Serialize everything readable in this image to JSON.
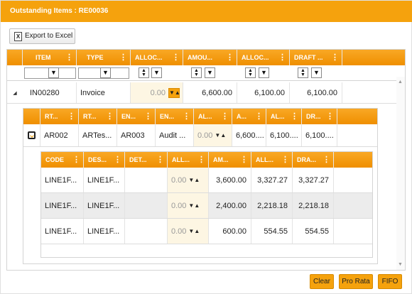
{
  "title": "Outstanding Items : RE00036",
  "toolbar": {
    "export_label": "Export to Excel",
    "export_icon": "excel-icon"
  },
  "main_grid": {
    "headers": [
      "ITEM",
      "TYPE",
      "ALLOC...",
      "AMOU...",
      "ALLOC...",
      "DRAFT ..."
    ],
    "row": {
      "item": "IN00280",
      "type": "Invoice",
      "alloc": "0.00",
      "amount": "6,600.00",
      "alloc2": "6,100.00",
      "draft": "6,100.00"
    }
  },
  "sub_grid": {
    "headers": [
      "RT...",
      "RT...",
      "EN...",
      "EN...",
      "AL...",
      "A...",
      "AL...",
      "DR..."
    ],
    "row": {
      "c1": "AR002",
      "c2": "ARTes...",
      "c3": "AR003",
      "c4": "Audit ...",
      "c5": "0.00",
      "c6": "6,600....",
      "c7": "6,100....",
      "c8": "6,100...."
    }
  },
  "line_grid": {
    "headers": [
      "CODE",
      "DES...",
      "DET...",
      "ALL...",
      "AM...",
      "ALL...",
      "DRA..."
    ],
    "rows": [
      {
        "code": "LINE1F...",
        "desc": "LINE1F...",
        "det": "",
        "alloc": "0.00",
        "amount": "3,600.00",
        "alloc2": "3,327.27",
        "draft": "3,327.27"
      },
      {
        "code": "LINE1F...",
        "desc": "LINE1F...",
        "det": "",
        "alloc": "0.00",
        "amount": "2,400.00",
        "alloc2": "2,218.18",
        "draft": "2,218.18"
      },
      {
        "code": "LINE1F...",
        "desc": "LINE1F...",
        "det": "",
        "alloc": "0.00",
        "amount": "600.00",
        "alloc2": "554.55",
        "draft": "554.55"
      }
    ]
  },
  "footer": {
    "clear_label": "Clear",
    "prorata_label": "Pro Rata",
    "fifo_label": "FIFO"
  },
  "colors": {
    "accent": "#f5a20d",
    "edit_cell": "#fdf6e3",
    "alt_row": "#ececec"
  }
}
